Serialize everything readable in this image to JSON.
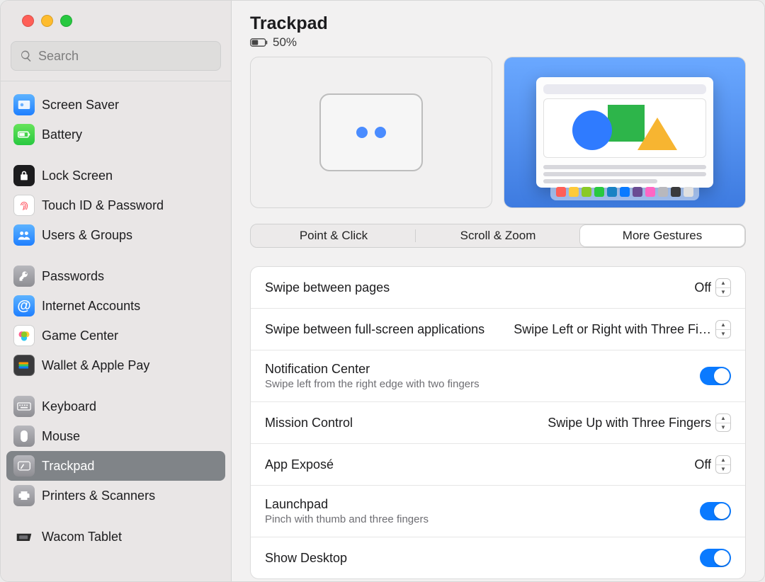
{
  "window": {
    "search_placeholder": "Search"
  },
  "sidebar": {
    "groups": [
      {
        "items": [
          {
            "label": "Screen Saver"
          },
          {
            "label": "Battery"
          }
        ]
      },
      {
        "items": [
          {
            "label": "Lock Screen"
          },
          {
            "label": "Touch ID & Password"
          },
          {
            "label": "Users & Groups"
          }
        ]
      },
      {
        "items": [
          {
            "label": "Passwords"
          },
          {
            "label": "Internet Accounts"
          },
          {
            "label": "Game Center"
          },
          {
            "label": "Wallet & Apple Pay"
          }
        ]
      },
      {
        "items": [
          {
            "label": "Keyboard"
          },
          {
            "label": "Mouse"
          },
          {
            "label": "Trackpad"
          },
          {
            "label": "Printers & Scanners"
          }
        ]
      },
      {
        "items": [
          {
            "label": "Wacom Tablet"
          }
        ]
      }
    ]
  },
  "header": {
    "title": "Trackpad",
    "battery_level": "50%"
  },
  "tabs": {
    "items": [
      {
        "label": "Point & Click"
      },
      {
        "label": "Scroll & Zoom"
      },
      {
        "label": "More Gestures"
      }
    ],
    "active_index": 2
  },
  "settings": {
    "swipe_pages": {
      "label": "Swipe between pages",
      "value": "Off"
    },
    "swipe_apps": {
      "label": "Swipe between full-screen applications",
      "value": "Swipe Left or Right with Three Fi…"
    },
    "notification_center": {
      "label": "Notification Center",
      "sub": "Swipe left from the right edge with two fingers",
      "on": true
    },
    "mission_control": {
      "label": "Mission Control",
      "value": "Swipe Up with Three Fingers"
    },
    "app_expose": {
      "label": "App Exposé",
      "value": "Off"
    },
    "launchpad": {
      "label": "Launchpad",
      "sub": "Pinch with thumb and three fingers",
      "on": true
    },
    "show_desktop": {
      "label": "Show Desktop",
      "on": true
    }
  },
  "dock_colors": [
    "#ff5f57",
    "#ffca3a",
    "#8ac926",
    "#28c840",
    "#1982c4",
    "#0a7aff",
    "#6a4c93",
    "#ff66c4",
    "#b8b8bd",
    "#3a3a3c",
    "#e0e0e0"
  ]
}
